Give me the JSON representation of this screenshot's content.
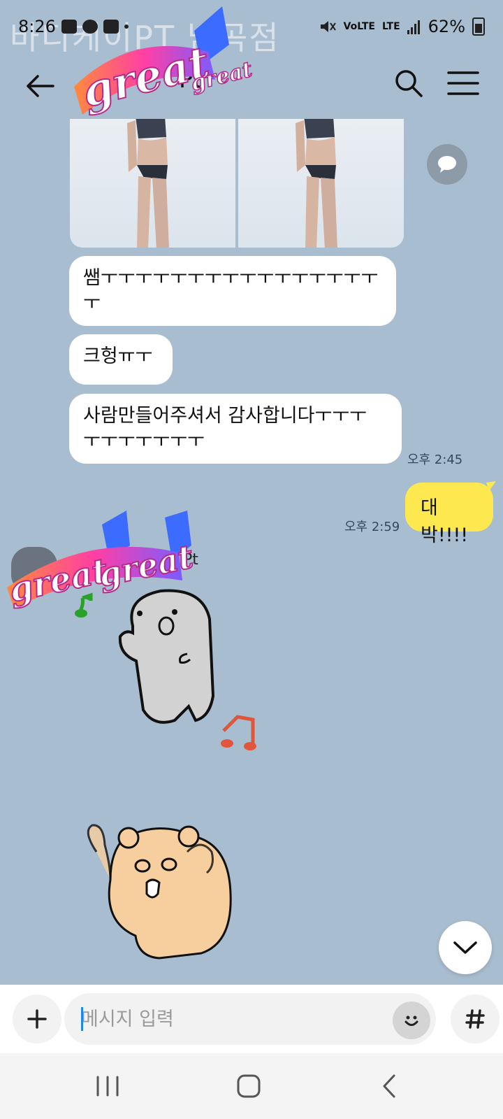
{
  "status_bar": {
    "time": "8:26",
    "volte": "VoLTE",
    "network": "LTE",
    "battery": "62%",
    "watermark": "바디케이PT 남곡점"
  },
  "header": {
    "title": "Pt",
    "sticker_text": "great great"
  },
  "messages": [
    {
      "side": "left",
      "type": "text",
      "text_line1": "쌤ㅜㅜㅜㅜㅜㅜㅜㅜㅜㅜㅜㅜㅜㅜㅜㅜ",
      "text_line2": "ㅜ"
    },
    {
      "side": "left",
      "type": "text",
      "text": "크헝ㅠㅜ"
    },
    {
      "side": "left",
      "type": "text",
      "text_line1": "사람만들어주셔서 감사합니다ㅜㅜㅜ",
      "text_line2": "ㅜㅜㅜㅜㅜㅜㅜ",
      "time": "오후 2:45"
    },
    {
      "side": "right",
      "type": "text",
      "text": "대박!!!!",
      "time": "오후 2:59"
    }
  ],
  "sender": {
    "name": "Pt"
  },
  "input": {
    "placeholder": "메시지 입력"
  },
  "colors": {
    "chat_bg": "#a9bdd0",
    "my_bubble": "#fde94f",
    "other_bubble": "#ffffff"
  }
}
